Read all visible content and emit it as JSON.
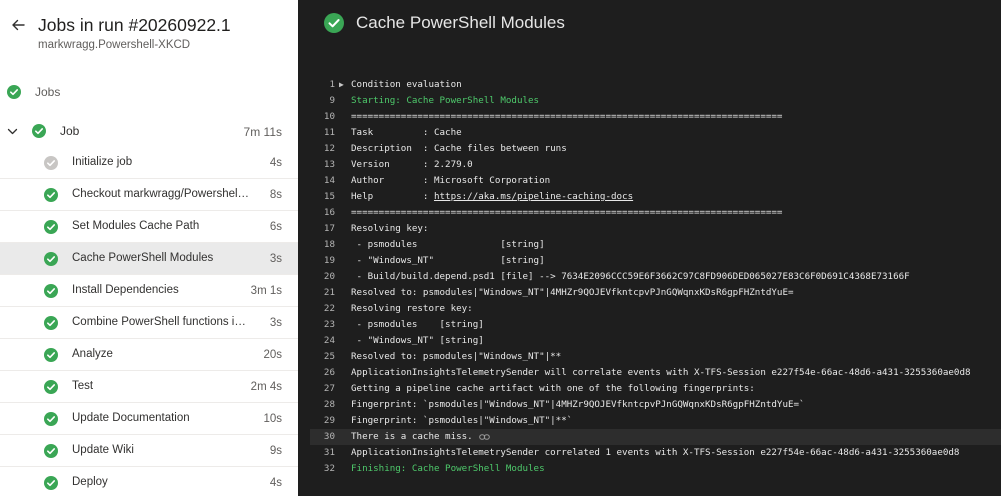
{
  "sidebar": {
    "title": "Jobs in run #20260922.1",
    "subtitle": "markwragg.Powershell-XKCD",
    "jobs_label": "Jobs",
    "job": {
      "name": "Job",
      "duration": "7m 11s"
    },
    "steps": [
      {
        "name": "Initialize job",
        "duration": "4s",
        "status": "skipped"
      },
      {
        "name": "Checkout markwragg/Powershell-...",
        "duration": "8s",
        "status": "success"
      },
      {
        "name": "Set Modules Cache Path",
        "duration": "6s",
        "status": "success"
      },
      {
        "name": "Cache PowerShell Modules",
        "duration": "3s",
        "status": "success",
        "selected": true
      },
      {
        "name": "Install Dependencies",
        "duration": "3m 1s",
        "status": "success"
      },
      {
        "name": "Combine PowerShell functions int...",
        "duration": "3s",
        "status": "success"
      },
      {
        "name": "Analyze",
        "duration": "20s",
        "status": "success"
      },
      {
        "name": "Test",
        "duration": "2m 4s",
        "status": "success"
      },
      {
        "name": "Update Documentation",
        "duration": "10s",
        "status": "success"
      },
      {
        "name": "Update Wiki",
        "duration": "9s",
        "status": "success"
      },
      {
        "name": "Deploy",
        "duration": "4s",
        "status": "success"
      }
    ]
  },
  "log_panel": {
    "title": "Cache PowerShell Modules",
    "lines": [
      {
        "num": "1",
        "text": "Condition evaluation",
        "collapsible": true
      },
      {
        "num": "9",
        "text": "Starting: Cache PowerShell Modules",
        "style": "green"
      },
      {
        "num": "10",
        "text": "=============================================================================="
      },
      {
        "num": "11",
        "text": "Task         : Cache"
      },
      {
        "num": "12",
        "text": "Description  : Cache files between runs"
      },
      {
        "num": "13",
        "text": "Version      : 2.279.0"
      },
      {
        "num": "14",
        "text": "Author       : Microsoft Corporation"
      },
      {
        "num": "15",
        "text": "Help         : ",
        "link": "https://aka.ms/pipeline-caching-docs"
      },
      {
        "num": "16",
        "text": "=============================================================================="
      },
      {
        "num": "17",
        "text": "Resolving key:"
      },
      {
        "num": "18",
        "text": " - psmodules               [string]"
      },
      {
        "num": "19",
        "text": " - \"Windows_NT\"            [string]"
      },
      {
        "num": "20",
        "text": " - Build/build.depend.psd1 [file] --> 7634E2096CCC59E6F3662C97C8FD906DED065027E83C6F0D691C4368E73166F"
      },
      {
        "num": "21",
        "text": "Resolved to: psmodules|\"Windows_NT\"|4MHZr9QOJEVfkntcpvPJnGQWqnxKDsR6gpFHZntdYuE="
      },
      {
        "num": "22",
        "text": "Resolving restore key:"
      },
      {
        "num": "23",
        "text": " - psmodules    [string]"
      },
      {
        "num": "24",
        "text": " - \"Windows_NT\" [string]"
      },
      {
        "num": "25",
        "text": "Resolved to: psmodules|\"Windows_NT\"|**"
      },
      {
        "num": "26",
        "text": "ApplicationInsightsTelemetrySender will correlate events with X-TFS-Session e227f54e-66ac-48d6-a431-3255360ae0d8"
      },
      {
        "num": "27",
        "text": "Getting a pipeline cache artifact with one of the following fingerprints:"
      },
      {
        "num": "28",
        "text": "Fingerprint: `psmodules|\"Windows_NT\"|4MHZr9QOJEVfkntcpvPJnGQWqnxKDsR6gpFHZntdYuE=`"
      },
      {
        "num": "29",
        "text": "Fingerprint: `psmodules|\"Windows_NT\"|**`"
      },
      {
        "num": "30",
        "text": "There is a cache miss.",
        "highlighted": true,
        "chain": true
      },
      {
        "num": "31",
        "text": "ApplicationInsightsTelemetrySender correlated 1 events with X-TFS-Session e227f54e-66ac-48d6-a431-3255360ae0d8"
      },
      {
        "num": "32",
        "text": "Finishing: Cache PowerShell Modules",
        "style": "green"
      }
    ]
  },
  "colors": {
    "success": "#3aa655",
    "skipped": "#c8c6c4",
    "log_green": "#4ec96b"
  }
}
